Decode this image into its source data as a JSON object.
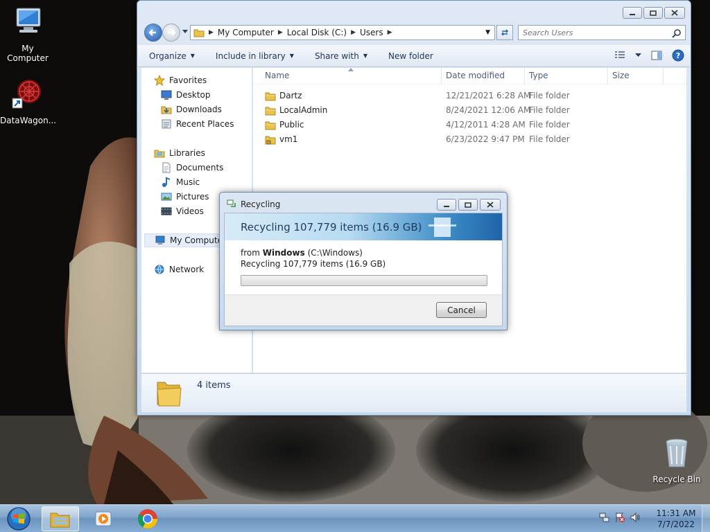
{
  "desktop": {
    "icons": [
      {
        "label": "My Computer"
      },
      {
        "label": "DataWagon..."
      },
      {
        "label": "Recycle Bin"
      }
    ]
  },
  "explorer": {
    "breadcrumb": [
      "My Computer",
      "Local Disk (C:)",
      "Users"
    ],
    "search_placeholder": "Search Users",
    "toolbar": {
      "organize": "Organize",
      "include_in_library": "Include in library",
      "share_with": "Share with",
      "new_folder": "New folder"
    },
    "nav": {
      "favorites": "Favorites",
      "desktop": "Desktop",
      "downloads": "Downloads",
      "recent_places": "Recent Places",
      "libraries": "Libraries",
      "documents": "Documents",
      "music": "Music",
      "pictures": "Pictures",
      "videos": "Videos",
      "my_computer": "My Computer",
      "network": "Network"
    },
    "columns": {
      "name": "Name",
      "date_modified": "Date modified",
      "type": "Type",
      "size": "Size"
    },
    "files": [
      {
        "name": "Dartz",
        "date": "12/21/2021 6:28 AM",
        "type": "File folder"
      },
      {
        "name": "LocalAdmin",
        "date": "8/24/2021 12:06 AM",
        "type": "File folder"
      },
      {
        "name": "Public",
        "date": "4/12/2011 4:28 AM",
        "type": "File folder"
      },
      {
        "name": "vm1",
        "date": "6/23/2022 9:47 PM",
        "type": "File folder"
      }
    ],
    "items_count": "4 items"
  },
  "dialog": {
    "title": "Recycling",
    "banner": "Recycling 107,779 items (16.9 GB)",
    "from_prefix": "from",
    "from_name": "Windows",
    "from_path": "(C:\\Windows)",
    "status": "Recycling 107,779 items (16.9 GB)",
    "progress": 0,
    "cancel": "Cancel"
  },
  "taskbar": {
    "time": "11:31 AM",
    "date": "7/7/2022"
  },
  "colors": {
    "accent": "#2a5fae",
    "folder": "#e9c34f",
    "progress_fill": "#65bb3f"
  }
}
